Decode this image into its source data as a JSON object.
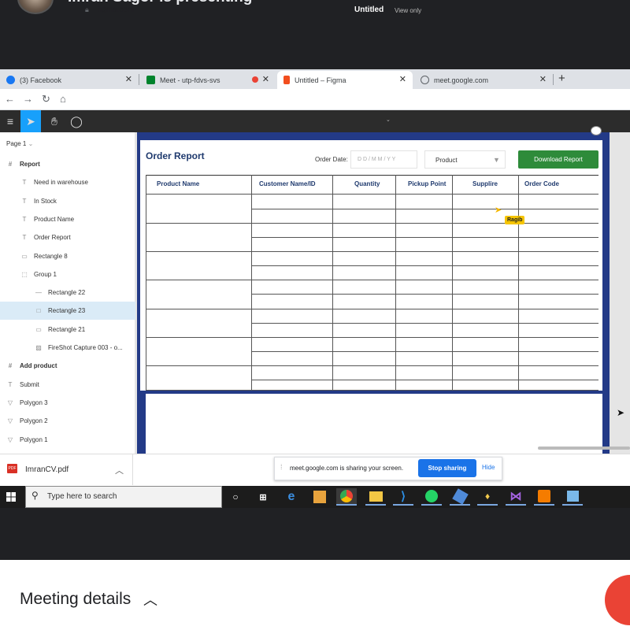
{
  "meet": {
    "presenter_text": "Imran Sagor is presenting",
    "meeting_details": "Meeting details"
  },
  "browser": {
    "tabs": [
      {
        "label": "(3) Facebook",
        "color": "#1877f2"
      },
      {
        "label": "Meet - utp-fdvs-svs",
        "color": "#00832d"
      },
      {
        "label": "Untitled – Figma",
        "color": "#f24e1e"
      },
      {
        "label": "meet.google.com",
        "color": "#5f6368"
      }
    ],
    "url": "figma.com"
  },
  "figma": {
    "title": "Untitled",
    "view_mode": "View only",
    "page": "Page 1",
    "layers": [
      {
        "label": "Report",
        "icon": "#",
        "bold": true
      },
      {
        "label": "Need in warehouse",
        "icon": "T"
      },
      {
        "label": "In Stock",
        "icon": "T"
      },
      {
        "label": "Product Name",
        "icon": "T"
      },
      {
        "label": "Order Report",
        "icon": "T"
      },
      {
        "label": "Rectangle 8",
        "icon": "▭"
      },
      {
        "label": "Group 1",
        "icon": "⬚"
      },
      {
        "label": "Rectangle 22",
        "icon": "—"
      },
      {
        "label": "Rectangle 23",
        "icon": "□",
        "selected": true
      },
      {
        "label": "Rectangle 21",
        "icon": "▭"
      },
      {
        "label": "FireShot Capture 003 - o...",
        "icon": "▨"
      },
      {
        "label": "Add product",
        "icon": "#",
        "bold": true
      },
      {
        "label": "Submit",
        "icon": "T"
      },
      {
        "label": "Polygon 3",
        "icon": "▽"
      },
      {
        "label": "Polygon 2",
        "icon": "▽"
      },
      {
        "label": "Polygon 1",
        "icon": "▽"
      }
    ]
  },
  "report": {
    "title": "Order Report",
    "order_date_label": "Order Date:",
    "date_placeholder": "D D / M M / Y Y",
    "product_select": "Product",
    "download_button": "Download Report",
    "columns": [
      "Product Name",
      "Customer Name/ID",
      "Quantity",
      "Pickup Point",
      "Supplire",
      "Order Code"
    ],
    "cursor_user": "Ragib"
  },
  "download": {
    "filename": "ImranCV.pdf",
    "icon_label": "PDF"
  },
  "share_bar": {
    "message": "meet.google.com is sharing your screen.",
    "stop": "Stop sharing",
    "hide": "Hide"
  },
  "taskbar": {
    "search_placeholder": "Type here to search"
  }
}
